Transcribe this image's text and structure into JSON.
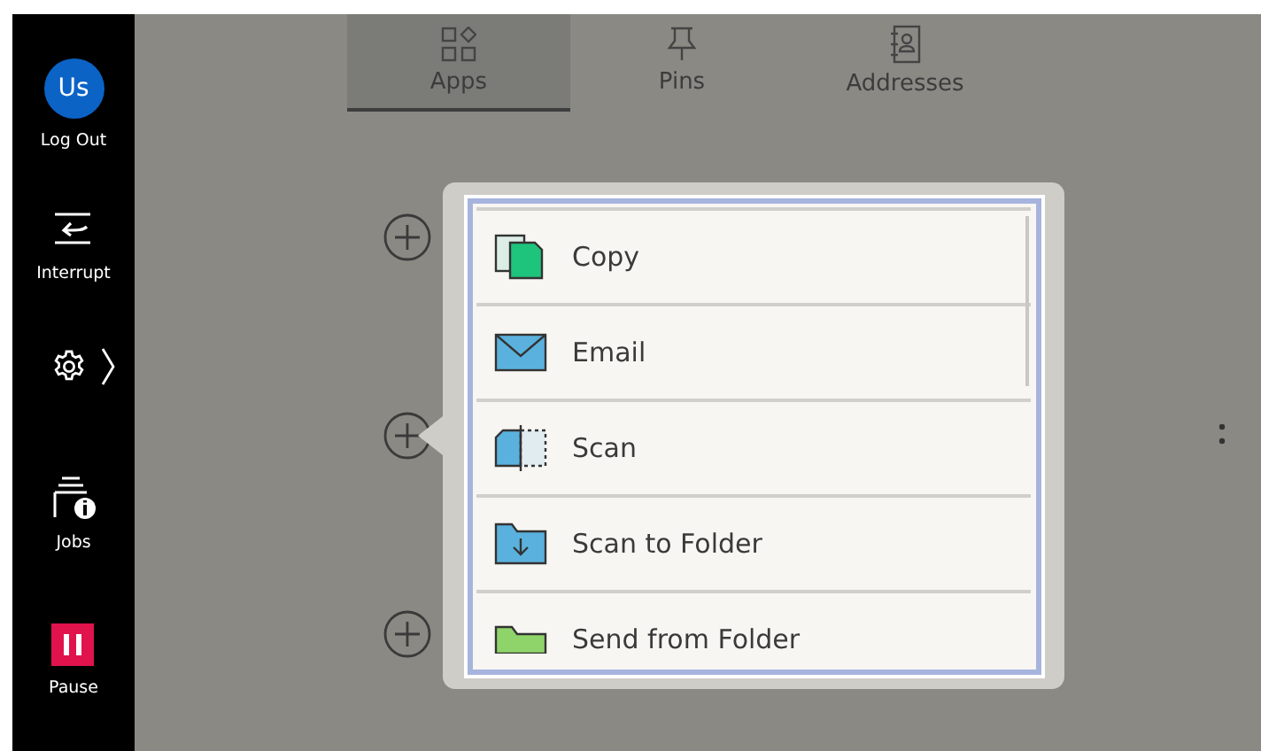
{
  "sidebar": {
    "user": {
      "initials": "Us",
      "label": "Log Out"
    },
    "items": [
      {
        "kind": "interrupt",
        "label": "Interrupt"
      },
      {
        "kind": "settings"
      },
      {
        "kind": "jobs",
        "label": "Jobs"
      },
      {
        "kind": "pause",
        "label": "Pause"
      }
    ]
  },
  "tabs": [
    {
      "kind": "apps",
      "label": "Apps",
      "selected": true
    },
    {
      "kind": "pins",
      "label": "Pins",
      "selected": false
    },
    {
      "kind": "addresses",
      "label": "Addresses",
      "selected": false
    }
  ],
  "popup": {
    "items": [
      {
        "kind": "copy",
        "label": "Copy"
      },
      {
        "kind": "email",
        "label": "Email"
      },
      {
        "kind": "scan",
        "label": "Scan"
      },
      {
        "kind": "scan-folder",
        "label": "Scan to Folder"
      },
      {
        "kind": "send-folder",
        "label": "Send from Folder"
      }
    ]
  }
}
